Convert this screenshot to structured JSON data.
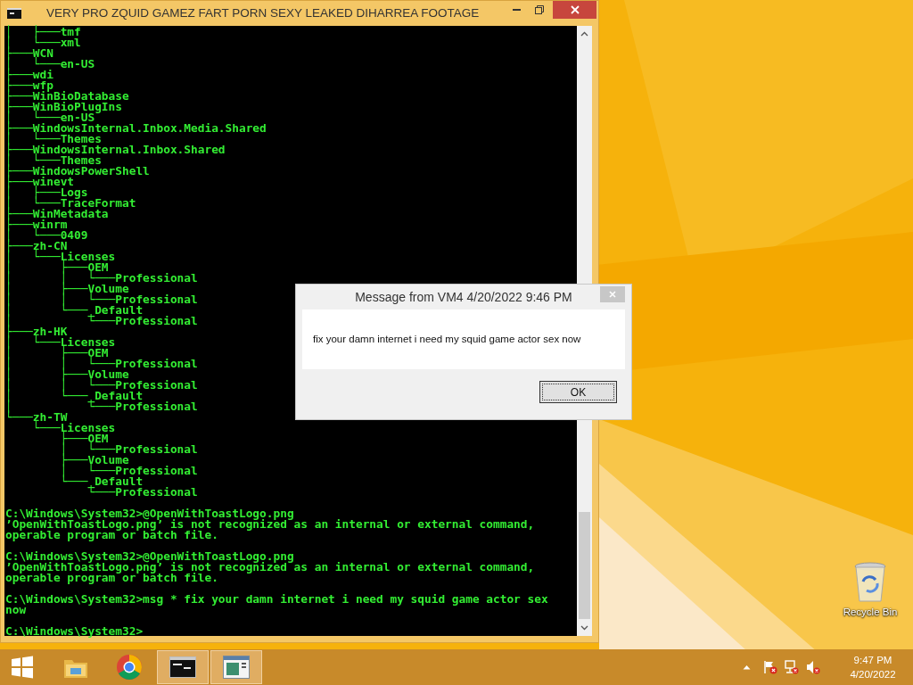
{
  "console_window": {
    "title": "VERY PRO ZQUID GAMEZ FART PORN SEXY LEAKED DIHARREA FOOTAGE",
    "blocks": [
      [
        "│   ├───tmf",
        "│   └───xml",
        "├───WCN",
        "│   └───en-US",
        "├───wdi",
        "├───wfp",
        "├───WinBioDatabase",
        "├───WinBioPlugIns",
        "│   └───en-US",
        "├───WindowsInternal.Inbox.Media.Shared",
        "│   └───Themes",
        "├───WindowsInternal.Inbox.Shared",
        "│   └───Themes",
        "├───WindowsPowerShell",
        "├───winevt",
        "│   ├───Logs",
        "│   └───TraceFormat",
        "├───WinMetadata",
        "├───winrm",
        "│   └───0409",
        "├───zh-CN",
        "│   └───Licenses",
        "│       ├───OEM",
        "│       │   └───Professional",
        "│       ├───Volume",
        "│       │   └───Professional",
        "│       └───_Default",
        "│           └───Professional",
        "├───zh-HK",
        "│   └───Licenses",
        "│       ├───OEM",
        "│       │   └───Professional",
        "│       ├───Volume",
        "│       │   └───Professional",
        "│       └───_Default",
        "│           └───Professional",
        "└───zh-TW",
        "    └───Licenses",
        "        ├───OEM",
        "        │   └───Professional",
        "        ├───Volume",
        "        │   └───Professional",
        "        └───_Default",
        "            └───Professional"
      ],
      [
        "C:\\Windows\\System32>@OpenWithToastLogo.png",
        "’OpenWithToastLogo.png’ is not recognized as an internal or external command,",
        "operable program or batch file."
      ],
      [
        "C:\\Windows\\System32>@OpenWithToastLogo.png",
        "’OpenWithToastLogo.png’ is not recognized as an internal or external command,",
        "operable program or batch file."
      ],
      [
        "C:\\Windows\\System32>msg * fix your damn internet i need my squid game actor sex",
        "now"
      ],
      [
        "C:\\Windows\\System32>"
      ]
    ]
  },
  "message_box": {
    "title": "Message from VM4 4/20/2022 9:46 PM",
    "message": "fix your damn internet i need my squid game actor sex now",
    "button": "OK"
  },
  "desktop_icons": [
    {
      "label": "Recycle Bin"
    }
  ],
  "taskbar": {
    "apps": [
      {
        "kind": "explorer",
        "open": false
      },
      {
        "kind": "chrome",
        "open": false
      },
      {
        "kind": "console",
        "open": true
      },
      {
        "kind": "window",
        "open": true
      }
    ],
    "clock": {
      "time": "9:47 PM",
      "date": "4/20/2022"
    }
  }
}
